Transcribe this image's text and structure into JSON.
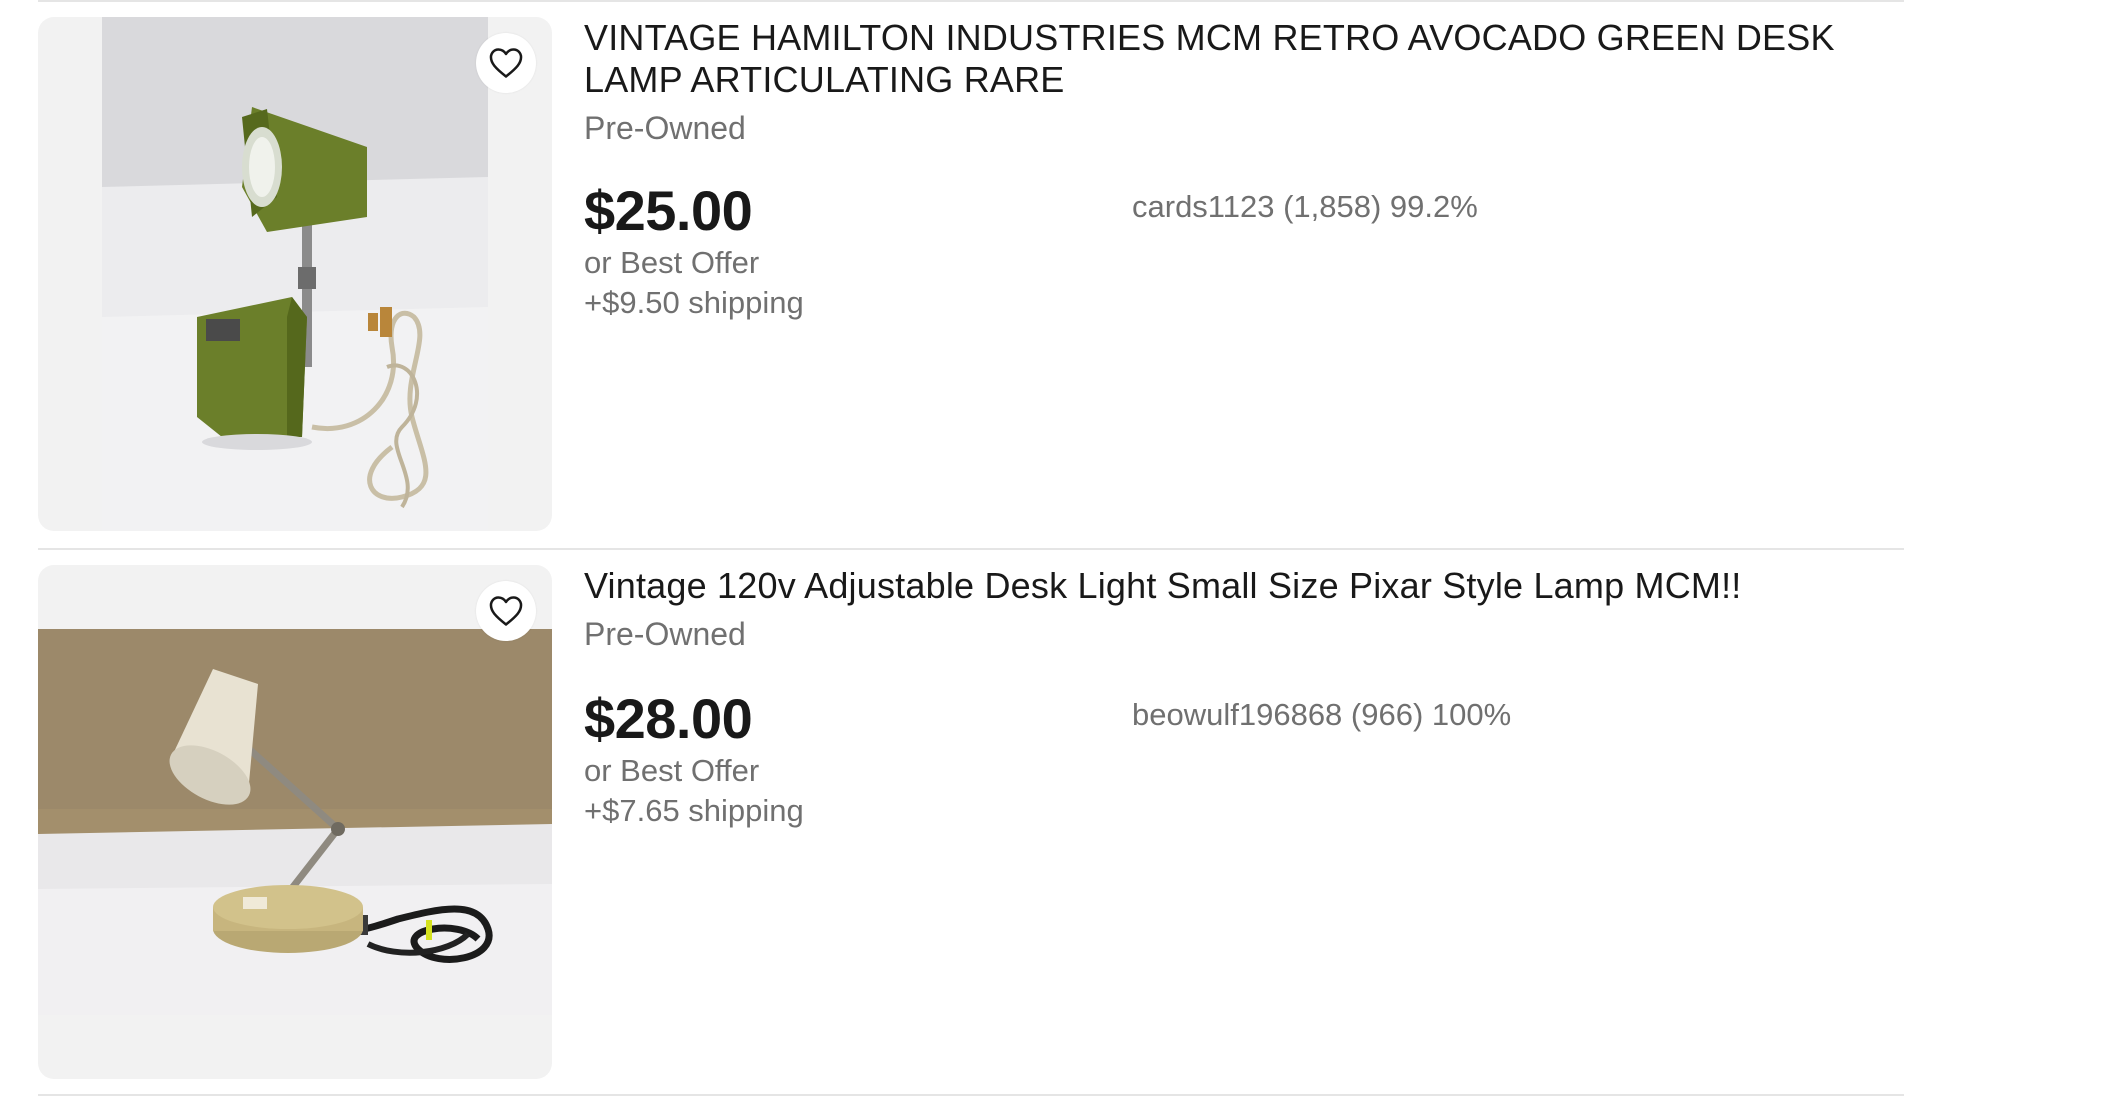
{
  "listings": [
    {
      "title": "VINTAGE HAMILTON INDUSTRIES MCM RETRO AVOCADO GREEN DESK LAMP ARTICULATING RARE",
      "condition": "Pre-Owned",
      "price": "$25.00",
      "best_offer": "or Best Offer",
      "shipping": "+$9.50 shipping",
      "seller": "cards1123 (1,858) 99.2%",
      "watch_icon": "heart-outline-icon"
    },
    {
      "title": "Vintage 120v Adjustable Desk Light Small Size Pixar Style Lamp MCM!!",
      "condition": "Pre-Owned",
      "price": "$28.00",
      "best_offer": "or Best Offer",
      "shipping": "+$7.65 shipping",
      "seller": "beowulf196868 (966) 100%",
      "watch_icon": "heart-outline-icon"
    }
  ],
  "colors": {
    "text_primary": "#191919",
    "text_secondary": "#707070",
    "image_background": "#f2f2f2",
    "divider": "#e5e5e5",
    "lamp_green": "#6b7f2a",
    "lamp_cream": "#e8e2d2",
    "wall_tan": "#a08e6c"
  }
}
